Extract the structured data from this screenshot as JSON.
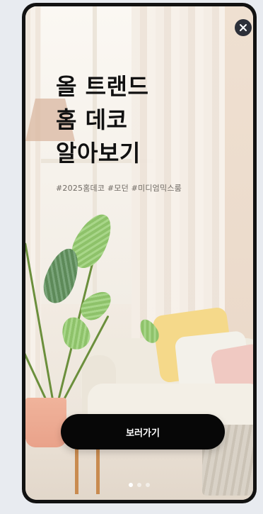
{
  "promo": {
    "headline_lines": [
      "올 트랜드",
      "홈 데코",
      "알아보기"
    ],
    "hashtags": "#2025홈데코 #모던 #미디엄믹스룸",
    "cta_label": "보러가기",
    "close_icon": "close-icon",
    "pagination": {
      "total": 3,
      "active_index": 0
    }
  },
  "colors": {
    "cta_background": "#070707",
    "cta_text": "#ffffff",
    "close_background": "#2d3039",
    "headline": "#111111"
  }
}
